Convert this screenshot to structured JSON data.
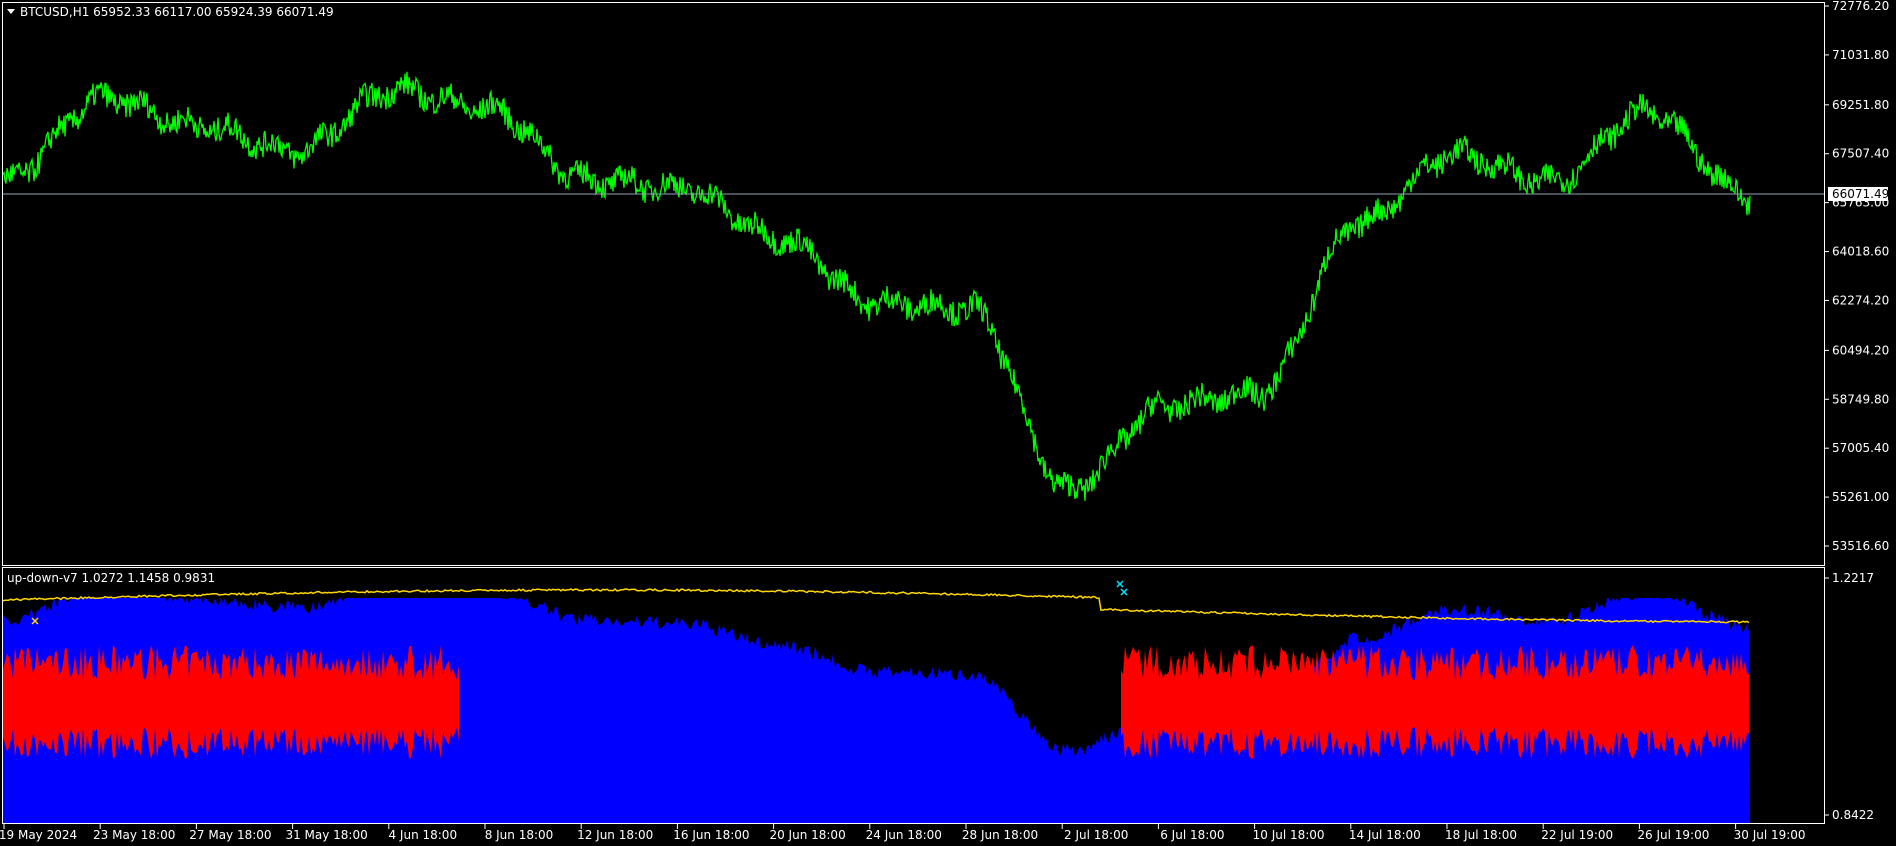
{
  "main_panel": {
    "symbol_info": "BTCUSD,H1  65952.33 66117.00 65924.39 66071.49",
    "price_axis_ticks": [
      "72776.20",
      "71031.80",
      "69251.80",
      "67507.40",
      "65763.00",
      "64018.60",
      "62274.20",
      "60494.20",
      "58749.80",
      "57005.40",
      "55261.00",
      "53516.60"
    ],
    "current_price_label": "66071.49",
    "current_price": 66071.49,
    "colors": {
      "price_line": "#00ff00",
      "axis": "#ffffff",
      "current_price_line": "#8fa3b4"
    }
  },
  "indicator_panel": {
    "label": "up-down-v7 1.0272 1.1458 0.9831",
    "axis_ticks": [
      "1.2217",
      "0.8422"
    ],
    "colors": {
      "up_area": "#0000ff",
      "down_area": "#ff0000",
      "signal_line": "#ffd700",
      "marker": "#00e5ff"
    }
  },
  "time_axis_labels": [
    "19 May 2024",
    "23 May 18:00",
    "27 May 18:00",
    "31 May 18:00",
    "4 Jun 18:00",
    "8 Jun 18:00",
    "12 Jun 18:00",
    "16 Jun 18:00",
    "20 Jun 18:00",
    "24 Jun 18:00",
    "28 Jun 18:00",
    "2 Jul 18:00",
    "6 Jul 18:00",
    "10 Jul 18:00",
    "14 Jul 18:00",
    "18 Jul 18:00",
    "22 Jul 19:00",
    "26 Jul 19:00",
    "30 Jul 19:00"
  ],
  "chart_data": {
    "type": "line",
    "title": "BTCUSD,H1",
    "ylim": [
      53516.6,
      72776.2
    ],
    "x": [
      "19 May 2024",
      "23 May 18:00",
      "27 May 18:00",
      "31 May 18:00",
      "4 Jun 18:00",
      "8 Jun 18:00",
      "12 Jun 18:00",
      "16 Jun 18:00",
      "20 Jun 18:00",
      "24 Jun 18:00",
      "28 Jun 18:00",
      "2 Jul 18:00",
      "6 Jul 18:00",
      "10 Jul 18:00",
      "14 Jul 18:00",
      "18 Jul 18:00",
      "22 Jul 19:00",
      "26 Jul 19:00",
      "30 Jul 19:00"
    ],
    "series": [
      {
        "values": [
          66500,
          69500,
          68500,
          67600,
          69800,
          69100,
          66600,
          66300,
          64500,
          62200,
          62000,
          55500,
          58500,
          59000,
          65000,
          67500,
          66500,
          69000,
          66000
        ]
      }
    ]
  }
}
